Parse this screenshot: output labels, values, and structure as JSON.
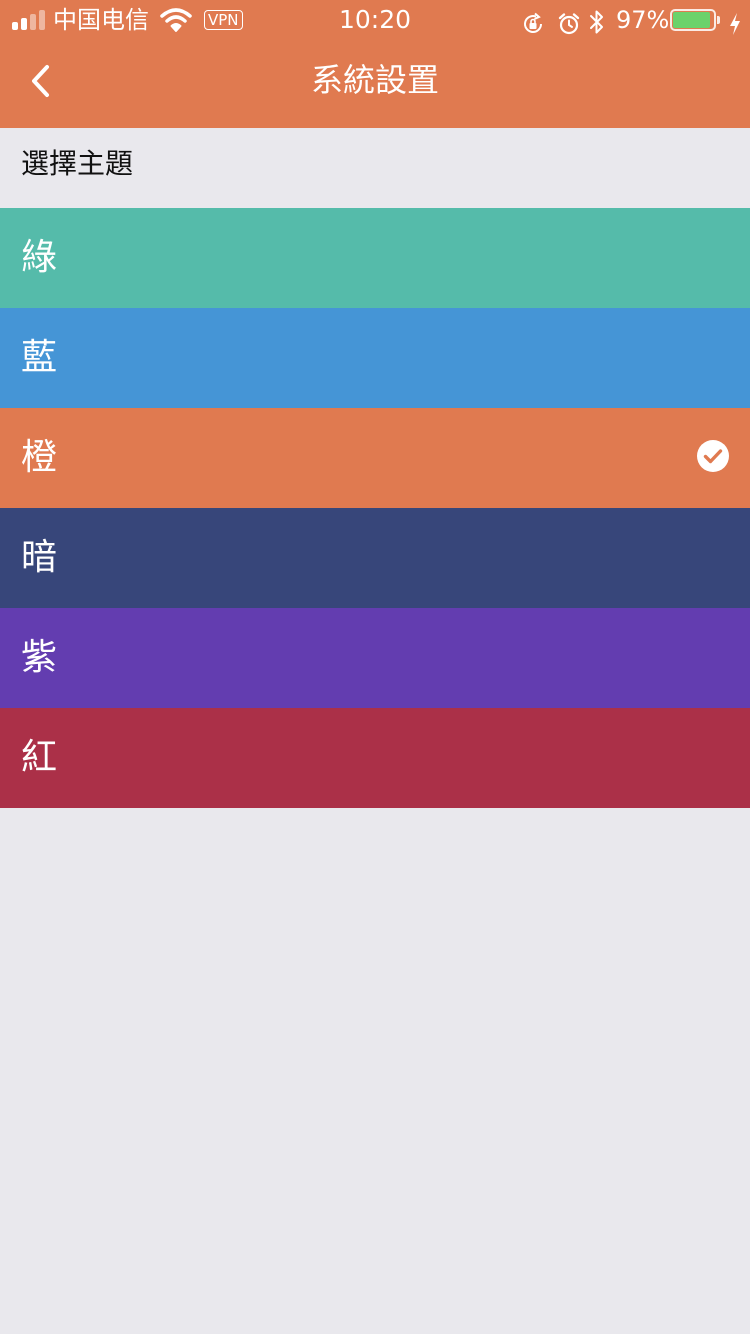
{
  "status_bar": {
    "carrier": "中国电信",
    "vpn": "VPN",
    "time": "10:20",
    "battery_percent_label": "97%",
    "battery_level": 0.97,
    "signal_bars_filled": 2,
    "signal_bars_total": 4,
    "icons": [
      "signal-icon",
      "wifi-icon",
      "rotation-lock-icon",
      "alarm-icon",
      "bluetooth-icon",
      "battery-icon",
      "charging-icon"
    ]
  },
  "nav": {
    "back_icon": "chevron-left-icon",
    "title": "系統設置"
  },
  "section": {
    "title": "選擇主題"
  },
  "themes": [
    {
      "label": "綠",
      "color": "#55BBAA",
      "selected": false
    },
    {
      "label": "藍",
      "color": "#4595D6",
      "selected": false
    },
    {
      "label": "橙",
      "color": "#E07A50",
      "selected": true
    },
    {
      "label": "暗",
      "color": "#37467A",
      "selected": false
    },
    {
      "label": "紫",
      "color": "#633DB0",
      "selected": false
    },
    {
      "label": "紅",
      "color": "#AB3048",
      "selected": false
    }
  ],
  "colors": {
    "header": "#E07A50",
    "background": "#E9E8ED",
    "battery_fill": "#6BD26B"
  }
}
